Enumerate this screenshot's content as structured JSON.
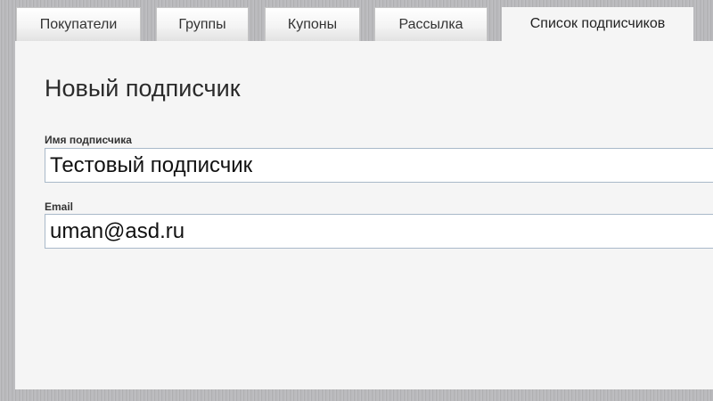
{
  "tabs": [
    {
      "label": "Покупатели",
      "active": false
    },
    {
      "label": "Группы",
      "active": false
    },
    {
      "label": "Купоны",
      "active": false
    },
    {
      "label": "Рассылка",
      "active": false
    },
    {
      "label": "Список подписчиков",
      "active": true
    }
  ],
  "form": {
    "title": "Новый подписчик",
    "name_label": "Имя подписчика",
    "name_value": "Тестовый подписчик",
    "email_label": "Email",
    "email_value": "uman@asd.ru"
  },
  "colors": {
    "background": "#b8b8bb",
    "panel": "#f5f5f5",
    "input_border": "#a9b9c9"
  }
}
